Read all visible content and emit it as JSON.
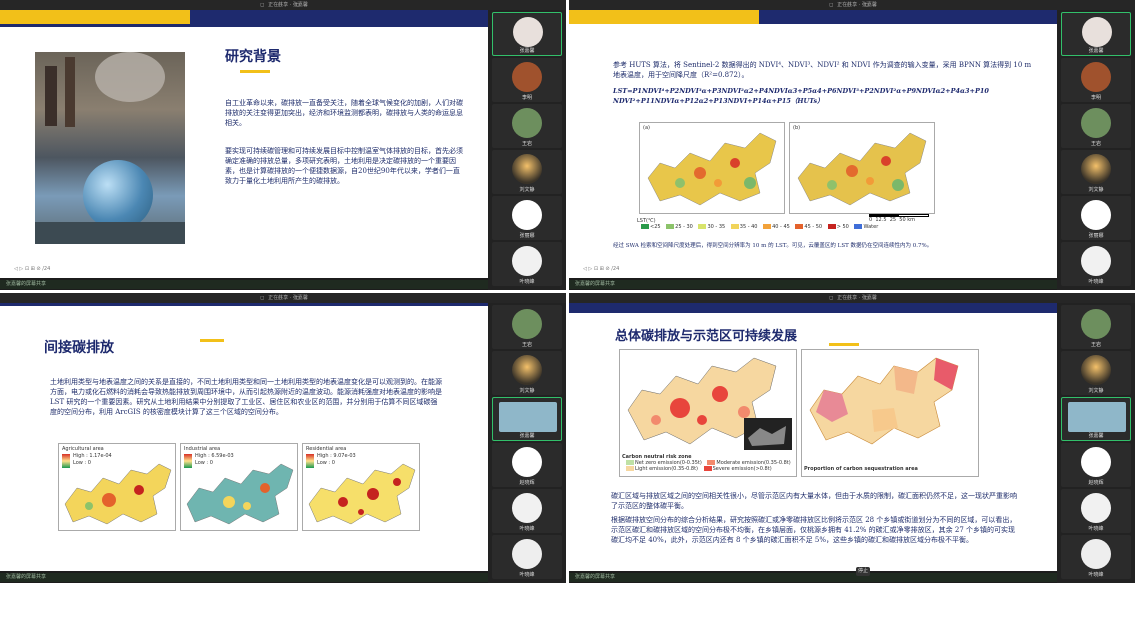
{
  "meeting_title": "正在共享 · 张嘉馨",
  "presenter_label": "张嘉馨的屏幕共享",
  "panels": {
    "tl": {
      "slide_title": "研究背景",
      "para1": "自工业革命以来，碳排放一直备受关注，随着全球气候变化的加剧，人们对碳排放的关注变得更加突出，经济和环境监测都表明，碳排放与人类的命运息息相关。",
      "para2": "要实现可持续碳管理和可持续发展目标中控制温室气体排放的目标，首先必须确定准确的排放总量，多项研究表明，土地利用是决定碳排放的一个重要因素，也是计算碳排放的一个便捷数据源，自20世纪90年代以来，学者们一直致力于量化土地利用所产生的碳排放。",
      "page": "/24"
    },
    "tr": {
      "para1": "参考 HUTS 算法，将 Sentinel-2 数据得出的 NDVI⁴、NDVI³、NDVI² 和 NDVI 作为调查的输入变量，采用 BPNN 算法得到 10 m 地表温度，用于空间降尺度（R²=0.872）。",
      "formula": "LST=P1NDVI⁴+P2NDVI³α+P3NDVI²α2+P4NDVIα3+P5α4+P6NDVI³+P2NDVI²α+P9NDVIα2+P4α3+P10 NDVI²+P11NDVIα+P12α2+P13NDVI+P14α+P15（HUTs）",
      "map_a": "(a)",
      "map_b": "(b)",
      "legend_title": "LST(℃)",
      "legend": [
        "<25",
        "25 - 30",
        "30 - 35",
        "35 - 40",
        "40 - 45",
        "45 - 50",
        "> 50",
        "Water"
      ],
      "scale": [
        "0",
        "12.5",
        "25",
        "50",
        "km"
      ],
      "caption": "经过 SWA 检索和空间降尺度处理后，得到空间分辨率为 10 m 的 LST。可见，云覆盖区的 LST 数据仍在空间连续性内为 0.7%。",
      "page": "/24"
    },
    "bl": {
      "slide_title": "间接碳排放",
      "para1": "土地利用类型与地表温度之间的关系是直接的，不同土地利用类型和同一土地利用类型的地表温度变化是可以观测到的。在能源方面，电力或化石燃料的消耗会导致热能排放到周围环境中，从而引起热源附近的温度波动。能源消耗强度对地表温度的影响是 LST 研究的一个重要因素。研究从土地利用结果中分别提取了工业区、居住区和农业区的范围，并分别用于估算不同区域碳强度的空间分布，利用 ArcGIS 的核密度模块计算了这三个区域的空间分布。",
      "maps": [
        {
          "label": "Agricultural area",
          "high": "High : 1.17e-04",
          "low": "Low : 0"
        },
        {
          "label": "Industrial area",
          "high": "High : 6.59e-03",
          "low": "Low : 0"
        },
        {
          "label": "Residential area",
          "high": "High : 9.07e-03",
          "low": "Low : 0"
        }
      ]
    },
    "br": {
      "slide_title": "总体碳排放与示范区可持续发展",
      "map_left_legend_title": "Carbon neutral risk zone",
      "map_left_legend": [
        "Net zero emission(0-0.35t)",
        "Moderate emission(0.35-0.8t)",
        "Light emission(0.35-0.8t)",
        "Severe emission(>0.8t)"
      ],
      "map_right_legend_title": "Proportion of carbon sequestration area",
      "para1": "碳汇区域与排放区域之间的空间相关性很小，尽管示范区内有大量水体，但由于水质的限制，碳汇面积仍然不足，这一现状严重影响了示范区的整体碳平衡。",
      "para2": "根据碳排放空间分布的综合分析结果，研究按照碳汇或净零碳排放区比例将示范区 28 个乡镇或街道划分为不同的区域，可以看出，示范区碳汇和碳排放区域的空间分布极不均衡，在乡镇层面，仅桃源乡拥有 41.2% 的碳汇或净零排放区，其余 27 个乡镇的可实现碳汇均不足 40%，此外，示范区内还有 8 个乡镇的碳汇面积不足 5%，这些乡镇的碳汇和碳排放区域分布极不平衡。",
      "share_btn": "停止"
    }
  },
  "participants": {
    "tl": [
      "张嘉馨",
      "李明",
      "王岩",
      "刘文静",
      "张丽娜",
      "叶晓峰"
    ],
    "tr": [
      "张嘉馨",
      "李明",
      "王岩",
      "刘文静",
      "张丽娜",
      "叶晓峰"
    ],
    "bl": [
      "王岩",
      "刘文静",
      "张嘉馨",
      "赵晓辉",
      "叶晓峰",
      "叶晓峰"
    ],
    "br": [
      "王岩",
      "刘文静",
      "张嘉馨",
      "赵晓辉",
      "叶晓峰",
      "叶晓峰"
    ]
  },
  "colors": {
    "navy": "#1e2a6e",
    "gold": "#f2c019",
    "active_border": "#32c06a"
  }
}
